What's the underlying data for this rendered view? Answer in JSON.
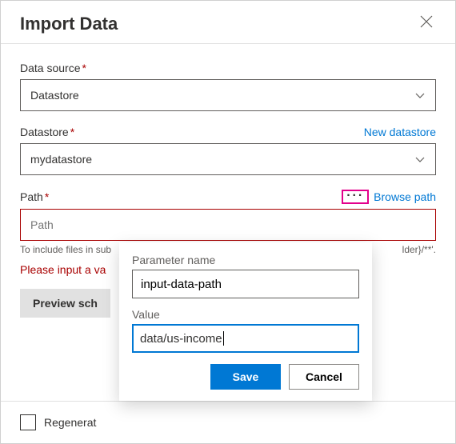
{
  "header": {
    "title": "Import Data"
  },
  "dataSource": {
    "label": "Data source",
    "value": "Datastore"
  },
  "datastore": {
    "label": "Datastore",
    "newLink": "New datastore",
    "value": "mydatastore"
  },
  "path": {
    "label": "Path",
    "placeholder": "Path",
    "browseLink": "Browse path",
    "help": "To include files in sub",
    "helpSuffix": "lder}/**'.",
    "error": "Please input a va"
  },
  "previewButton": "Preview sch",
  "footer": {
    "regenerate": "Regenerat"
  },
  "popover": {
    "paramLabel": "Parameter name",
    "paramValue": "input-data-path",
    "valueLabel": "Value",
    "valueValue": "data/us-income",
    "save": "Save",
    "cancel": "Cancel"
  }
}
